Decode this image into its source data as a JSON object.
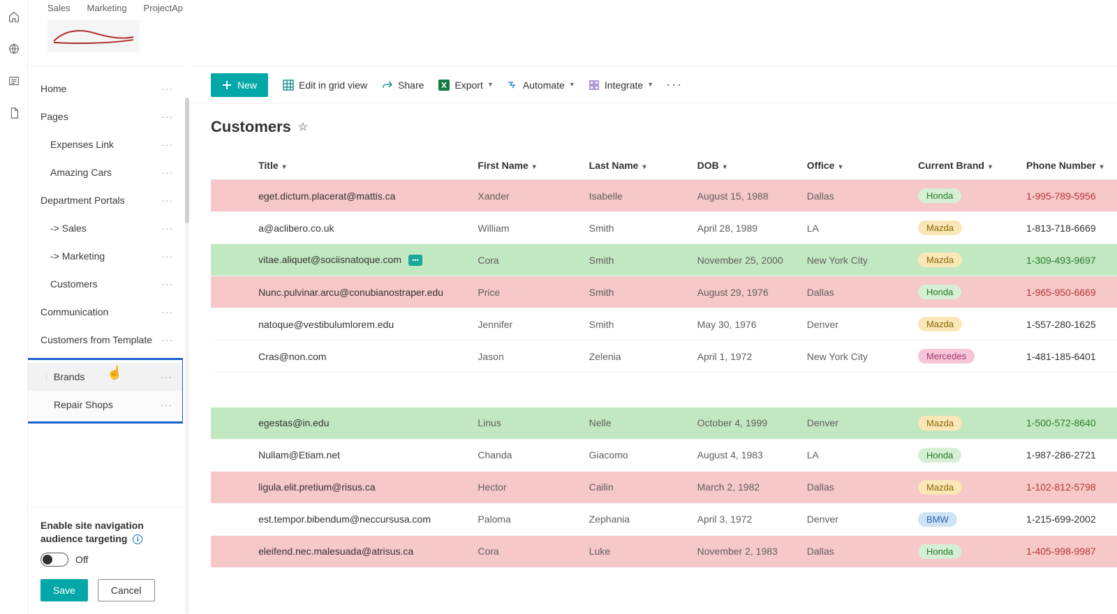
{
  "tabs": [
    "Sales",
    "Marketing",
    "ProjectApex"
  ],
  "sidebar": {
    "items": [
      {
        "label": "Home",
        "indent": 0
      },
      {
        "label": "Pages",
        "indent": 0
      },
      {
        "label": "Expenses Link",
        "indent": 1
      },
      {
        "label": "Amazing Cars",
        "indent": 1
      },
      {
        "label": "Department Portals",
        "indent": 0
      },
      {
        "label": "-> Sales",
        "indent": 1
      },
      {
        "label": "-> Marketing",
        "indent": 1
      },
      {
        "label": "Customers",
        "indent": 1
      },
      {
        "label": "Communication",
        "indent": 0
      },
      {
        "label": "Customers from Template",
        "indent": 0
      }
    ],
    "boxed": [
      "Brands",
      "Repair Shops"
    ]
  },
  "footer": {
    "title_l1": "Enable site navigation",
    "title_l2": "audience targeting",
    "toggle_label": "Off",
    "save_label": "Save",
    "cancel_label": "Cancel"
  },
  "cmdbar": {
    "new": "New",
    "edit": "Edit in grid view",
    "share": "Share",
    "export": "Export",
    "automate": "Automate",
    "integrate": "Integrate"
  },
  "list": {
    "title": "Customers",
    "columns": [
      "Title",
      "First Name",
      "Last Name",
      "DOB",
      "Office",
      "Current Brand",
      "Phone Number"
    ],
    "rows": [
      {
        "title": "eget.dictum.placerat@mattis.ca",
        "fn": "Xander",
        "ln": "Isabelle",
        "dob": "August 15, 1988",
        "office": "Dallas",
        "brand": "Honda",
        "phone": "1-995-789-5956",
        "tone": "red"
      },
      {
        "title": "a@aclibero.co.uk",
        "fn": "William",
        "ln": "Smith",
        "dob": "April 28, 1989",
        "office": "LA",
        "brand": "Mazda",
        "phone": "1-813-718-6669",
        "tone": "plain"
      },
      {
        "title": "vitae.aliquet@sociisnatoque.com",
        "fn": "Cora",
        "ln": "Smith",
        "dob": "November 25, 2000",
        "office": "New York City",
        "brand": "Mazda",
        "phone": "1-309-493-9697",
        "tone": "green",
        "comment": true
      },
      {
        "title": "Nunc.pulvinar.arcu@conubianostraper.edu",
        "fn": "Price",
        "ln": "Smith",
        "dob": "August 29, 1976",
        "office": "Dallas",
        "brand": "Honda",
        "phone": "1-965-950-6669",
        "tone": "red"
      },
      {
        "title": "natoque@vestibulumlorem.edu",
        "fn": "Jennifer",
        "ln": "Smith",
        "dob": "May 30, 1976",
        "office": "Denver",
        "brand": "Mazda",
        "phone": "1-557-280-1625",
        "tone": "plain"
      },
      {
        "title": "Cras@non.com",
        "fn": "Jason",
        "ln": "Zelenia",
        "dob": "April 1, 1972",
        "office": "New York City",
        "brand": "Mercedes",
        "phone": "1-481-185-6401",
        "tone": "plain"
      },
      {
        "spacer": true
      },
      {
        "title": "egestas@in.edu",
        "fn": "Linus",
        "ln": "Nelle",
        "dob": "October 4, 1999",
        "office": "Denver",
        "brand": "Mazda",
        "phone": "1-500-572-8640",
        "tone": "green"
      },
      {
        "title": "Nullam@Etiam.net",
        "fn": "Chanda",
        "ln": "Giacomo",
        "dob": "August 4, 1983",
        "office": "LA",
        "brand": "Honda",
        "phone": "1-987-286-2721",
        "tone": "plain"
      },
      {
        "title": "ligula.elit.pretium@risus.ca",
        "fn": "Hector",
        "ln": "Cailin",
        "dob": "March 2, 1982",
        "office": "Dallas",
        "brand": "Mazda",
        "phone": "1-102-812-5798",
        "tone": "red"
      },
      {
        "title": "est.tempor.bibendum@neccursusa.com",
        "fn": "Paloma",
        "ln": "Zephania",
        "dob": "April 3, 1972",
        "office": "Denver",
        "brand": "BMW",
        "phone": "1-215-699-2002",
        "tone": "plain"
      },
      {
        "title": "eleifend.nec.malesuada@atrisus.ca",
        "fn": "Cora",
        "ln": "Luke",
        "dob": "November 2, 1983",
        "office": "Dallas",
        "brand": "Honda",
        "phone": "1-405-998-9987",
        "tone": "red"
      }
    ]
  }
}
